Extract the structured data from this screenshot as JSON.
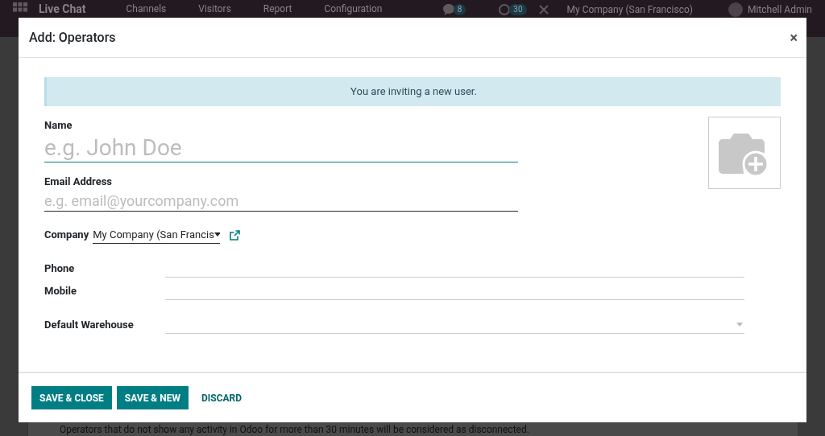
{
  "navbar": {
    "app_name": "Live Chat",
    "menus": [
      "Channels",
      "Visitors",
      "Report",
      "Configuration"
    ],
    "chat_count": "8",
    "activity_count": "30",
    "company": "My Company (San Francisco)",
    "user": "Mitchell Admin"
  },
  "page": {
    "footer_note": "Operators that do not show any activity in Odoo for more than 30 minutes will be considered as disconnected."
  },
  "dialog": {
    "title": "Add: Operators",
    "close": "×",
    "alert": "You are inviting a new user.",
    "name": {
      "label": "Name",
      "placeholder": "e.g. John Doe"
    },
    "email": {
      "label": "Email Address",
      "placeholder": "e.g. email@yourcompany.com"
    },
    "company": {
      "label": "Company",
      "value": "My Company (San Francis"
    },
    "fields": [
      {
        "label": "Phone",
        "kind": "text"
      },
      {
        "label": "Mobile",
        "kind": "text"
      },
      {
        "label": "Default Warehouse",
        "kind": "select"
      }
    ],
    "buttons": [
      {
        "label": "SAVE & CLOSE",
        "kind": "primary"
      },
      {
        "label": "SAVE & NEW",
        "kind": "primary"
      },
      {
        "label": "DISCARD",
        "kind": "link"
      }
    ]
  }
}
